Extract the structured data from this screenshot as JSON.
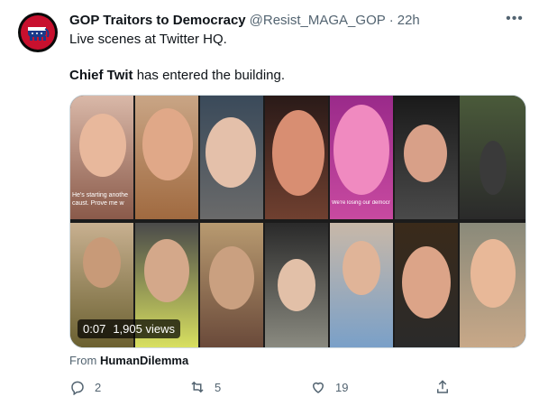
{
  "tweet": {
    "author_name": "GOP Traitors to Democracy",
    "handle": "@Resist_MAGA_GOP",
    "separator": "·",
    "time": "22h",
    "more_icon": "more-horizontal-icon",
    "line1": "Live scenes at Twitter HQ.",
    "line2_bold": "Chief Twit",
    "line2_rest": " has entered the building.",
    "video": {
      "duration": "0:07",
      "views": "1,905 views",
      "overlay_text_1": "He's starting anothe caust. Prove me w",
      "overlay_text_2": "We're losing our democr"
    },
    "from_label": "From ",
    "from_source": "HumanDilemma",
    "actions": {
      "reply_count": "2",
      "retweet_count": "5",
      "like_count": "19"
    }
  }
}
